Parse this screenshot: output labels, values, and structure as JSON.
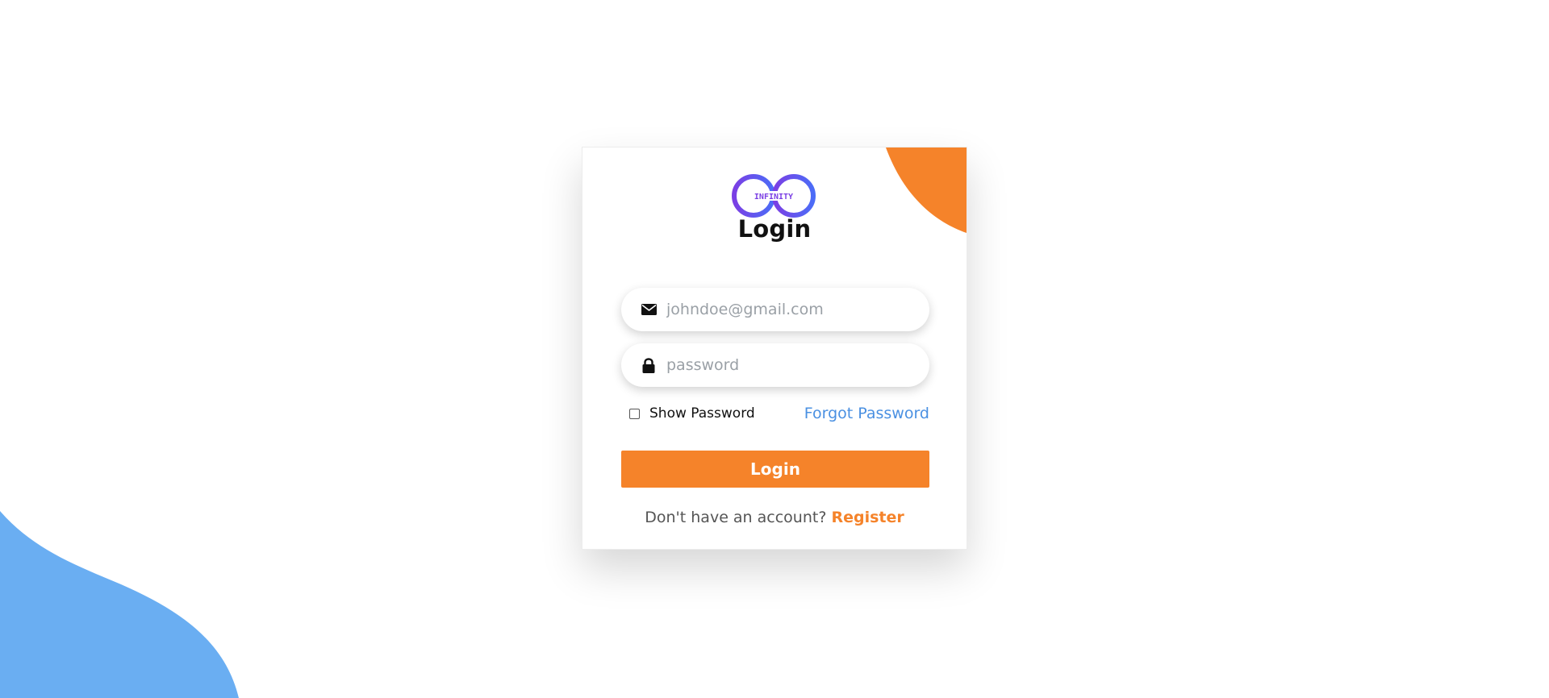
{
  "logo": {
    "text": "INFINITY",
    "gradient_start": "#7b3fe4",
    "gradient_end": "#4b6cf7"
  },
  "card": {
    "title": "Login"
  },
  "form": {
    "email": {
      "icon": "envelope-icon",
      "placeholder": "johndoe@gmail.com",
      "value": ""
    },
    "password": {
      "icon": "lock-icon",
      "placeholder": "password",
      "value": ""
    },
    "show_password_label": "Show Password",
    "show_password_checked": false,
    "forgot_password_label": "Forgot Password",
    "login_button_label": "Login"
  },
  "footer": {
    "prompt": "Don't have an account? ",
    "register_label": "Register"
  },
  "colors": {
    "accent": "#f5832a",
    "link": "#4a90e2",
    "blob": "#6aaef2"
  }
}
